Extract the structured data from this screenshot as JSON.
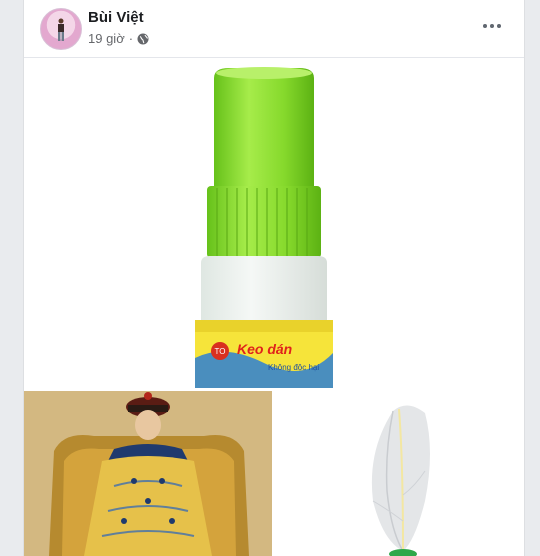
{
  "post": {
    "author": "Bùi Việt",
    "time": "19 giờ",
    "separator": "·",
    "privacy_icon": "globe-icon",
    "more_icon": "more-horizontal-icon"
  },
  "photos": {
    "main": {
      "label_text": "Keo dán",
      "sub_text": "Không độc hại",
      "brand_text": "TO"
    },
    "left": {
      "subject": "emperor-portrait"
    },
    "right": {
      "subject": "feather-pen"
    }
  },
  "colors": {
    "bottle_green": "#8fe02e",
    "page_bg": "#e9ebee"
  }
}
